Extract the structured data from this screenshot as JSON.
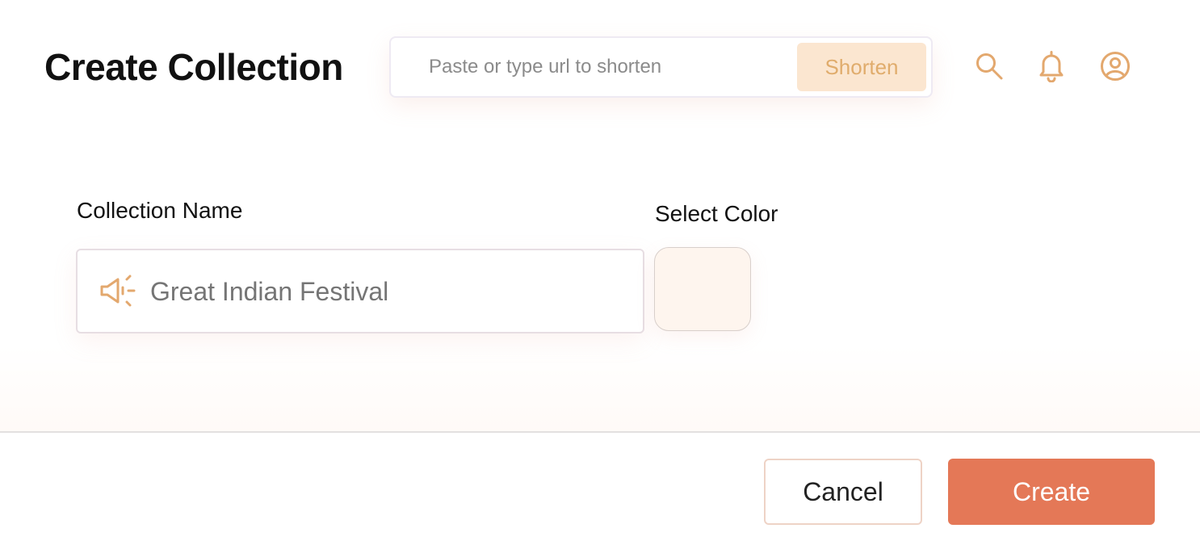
{
  "header": {
    "title": "Create Collection",
    "url_bar": {
      "placeholder": "Paste or type url to shorten",
      "value": "",
      "button_label": "Shorten"
    },
    "icons": [
      "search-icon",
      "bell-icon",
      "user-icon"
    ]
  },
  "form": {
    "name_label": "Collection Name",
    "name_placeholder": "Great Indian Festival",
    "name_value": "",
    "name_icon": "megaphone-icon",
    "color_label": "Select Color",
    "selected_color": "#fef5ee"
  },
  "footer": {
    "cancel_label": "Cancel",
    "create_label": "Create"
  },
  "colors": {
    "accent": "#e47857",
    "icon": "#e3a86e",
    "shorten_bg": "#fbe6d0"
  }
}
